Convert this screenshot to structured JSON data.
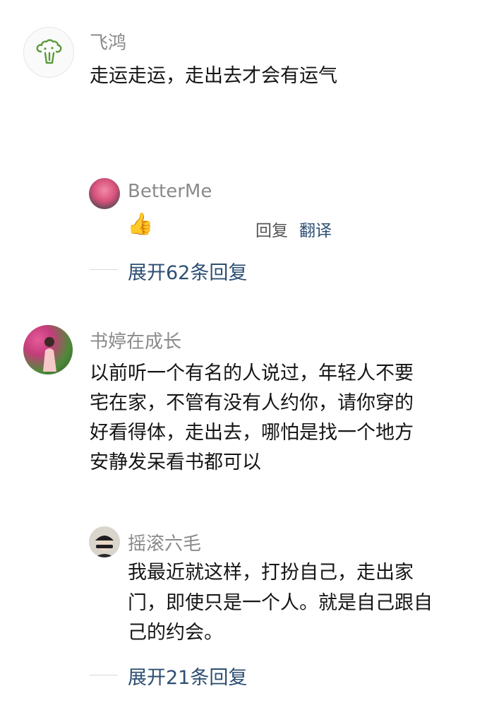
{
  "comments": [
    {
      "user": "飞鸿",
      "avatar_icon": "broccoli-icon",
      "text": "走运走运，走出去才会有运气",
      "reply": {
        "user": "BetterMe",
        "text": "👍",
        "actions": {
          "reply": "回复",
          "translate": "翻译"
        }
      },
      "expand": "展开62条回复"
    },
    {
      "user": "书婷在成长",
      "avatar_icon": "flower-portrait-avatar",
      "text_lines": [
        "以前听一个有名的人说过，年轻人不要",
        "宅在家，不管有没有人约你，请你穿的",
        "好看得体，走出去，哪怕是找一个地方",
        "安静发呆看书都可以"
      ],
      "reply": {
        "user": "摇滚六毛",
        "text_lines": [
          "我最近就这样，打扮自己，走出家",
          "门，即使只是一个人。就是自己跟自",
          "己的约会。"
        ]
      },
      "expand": "展开21条回复"
    }
  ],
  "colors": {
    "name": "#8a8a8a",
    "link": "#2d4f73",
    "text": "#151515"
  }
}
